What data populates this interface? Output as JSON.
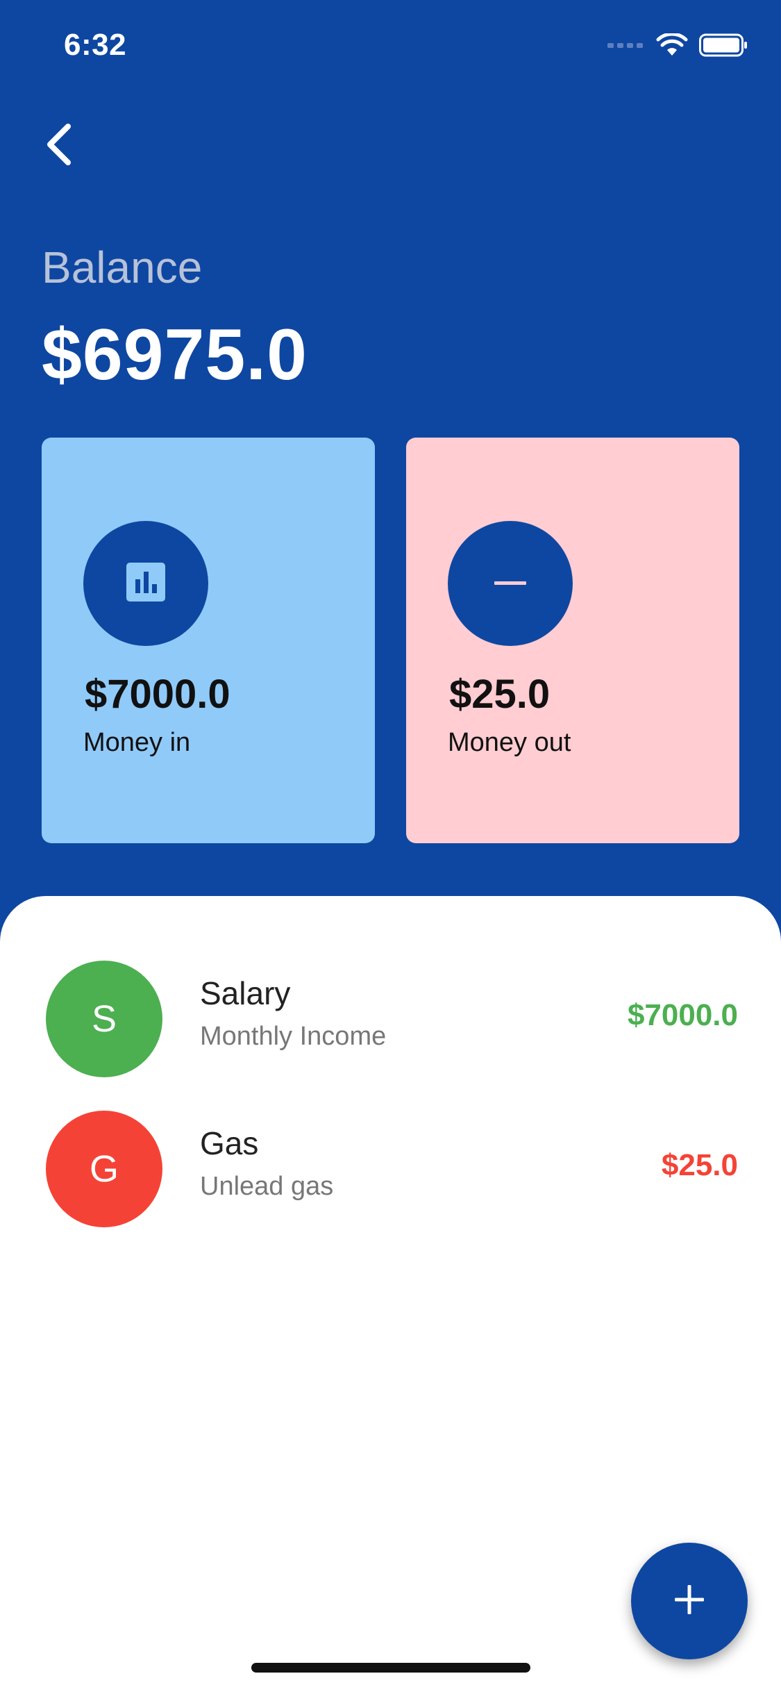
{
  "status_bar": {
    "time": "6:32"
  },
  "header": {
    "back_icon": "chevron-left-icon",
    "balance_label": "Balance",
    "balance_value": "$6975.0"
  },
  "summary": {
    "money_in": {
      "amount": "$7000.0",
      "label": "Money in",
      "icon": "bar-chart-icon",
      "color": "#90CAF9"
    },
    "money_out": {
      "amount": "$25.0",
      "label": "Money out",
      "icon": "minus-icon",
      "color": "#FFCDD2"
    }
  },
  "transactions": [
    {
      "initial": "S",
      "title": "Salary",
      "subtitle": "Monthly Income",
      "amount": "$7000.0",
      "avatar_color": "#4CAF50",
      "amount_color": "#4CAF50"
    },
    {
      "initial": "G",
      "title": "Gas",
      "subtitle": "Unlead gas",
      "amount": "$25.0",
      "avatar_color": "#F44336",
      "amount_color": "#F44336"
    }
  ],
  "fab": {
    "icon": "plus-icon"
  },
  "colors": {
    "primary": "#0E47A1",
    "income": "#4CAF50",
    "expense": "#F44336"
  }
}
